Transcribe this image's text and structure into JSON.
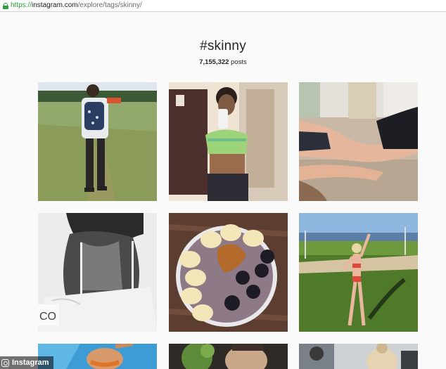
{
  "browser": {
    "url_protocol": "https://",
    "url_host": "instagram.com",
    "url_path": "/explore/tags/skinny/"
  },
  "tag": {
    "title": "#skinny",
    "post_count": "7,155,322",
    "post_label": " posts"
  },
  "watermark": "Instagram",
  "colors": {
    "background": "#fafafa",
    "text": "#262626",
    "secure": "#2e9e3e"
  },
  "grid": {
    "tiles": [
      {
        "subject": "man with backpack walking in a field"
      },
      {
        "subject": "mirror selfie in crop top"
      },
      {
        "subject": "person lying on carpet"
      },
      {
        "subject": "black and white back view"
      },
      {
        "subject": "smoothie bowl with banana and blackberries"
      },
      {
        "subject": "woman in bikini on lawn"
      },
      {
        "subject": "beach photo"
      },
      {
        "subject": "face close-up with plant"
      },
      {
        "subject": "people outdoors"
      }
    ]
  }
}
